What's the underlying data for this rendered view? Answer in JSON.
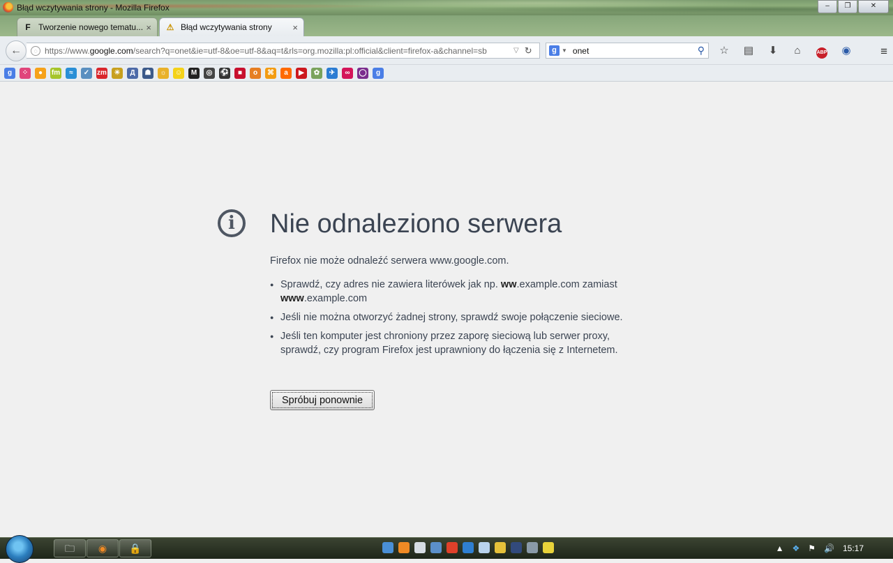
{
  "window": {
    "title": "Błąd wczytywania strony - Mozilla Firefox",
    "minimize": "‒",
    "maximize": "❐",
    "close": "✕"
  },
  "tabs": [
    {
      "label": "Tworzenie nowego tematu...",
      "favicon": "F",
      "close": "×"
    },
    {
      "label": "Błąd wczytywania strony",
      "favicon": "⚠",
      "close": "×"
    }
  ],
  "new_tab": "+",
  "navbar": {
    "back": "←",
    "url_prefix": "https://www.",
    "url_host": "google.com",
    "url_rest": "/search?q=onet&ie=utf-8&oe=utf-8&aq=t&rls=org.mozilla:pl:official&client=firefox-a&channel=sb",
    "url_drop": "▽",
    "reload": "↻",
    "search_engine_icon": "g",
    "search_drop": "▼",
    "search_value": "onet",
    "search_icon": "⚲",
    "icons": [
      "☆",
      "▤",
      "⬇",
      "⌂",
      "ABP",
      "◉"
    ],
    "menu": "≡"
  },
  "bookmarks": [
    {
      "label": "g",
      "color": "#4a7ee6"
    },
    {
      "label": "⁘",
      "color": "#e0457b"
    },
    {
      "label": "●",
      "color": "#f6a21a"
    },
    {
      "label": "fm",
      "color": "#a6c52a"
    },
    {
      "label": "≈",
      "color": "#2a8fd6"
    },
    {
      "label": "✓",
      "color": "#5a8fc0"
    },
    {
      "label": "zm",
      "color": "#d9262c"
    },
    {
      "label": "☀",
      "color": "#c8a01e"
    },
    {
      "label": "Д",
      "color": "#4c6aa8"
    },
    {
      "label": "☗",
      "color": "#3c5a8a"
    },
    {
      "label": "☼",
      "color": "#e9b12a"
    },
    {
      "label": "☺",
      "color": "#f4d21a"
    },
    {
      "label": "M",
      "color": "#222222"
    },
    {
      "label": "◎",
      "color": "#444444"
    },
    {
      "label": "⚽",
      "color": "#333333"
    },
    {
      "label": "■",
      "color": "#c8102e"
    },
    {
      "label": "o",
      "color": "#e67e22"
    },
    {
      "label": "⌘",
      "color": "#f39c12"
    },
    {
      "label": "a",
      "color": "#ff6a00"
    },
    {
      "label": "▶",
      "color": "#cc181e"
    },
    {
      "label": "✿",
      "color": "#7aa35c"
    },
    {
      "label": "✈",
      "color": "#2b7cd3"
    },
    {
      "label": "∞",
      "color": "#d4145a"
    },
    {
      "label": "◯",
      "color": "#7b2d8e"
    },
    {
      "label": "g",
      "color": "#4a7ee6"
    }
  ],
  "error": {
    "title": "Nie odnaleziono serwera",
    "description": "Firefox nie może odnaleźć serwera www.google.com.",
    "tip1_a": "Sprawdź, czy adres nie zawiera literówek jak np. ",
    "tip1_b1": "ww",
    "tip1_c": ".example.com zamiast ",
    "tip1_b2": "www",
    "tip1_d": ".example.com",
    "tip2": "Jeśli nie można otworzyć żadnej strony, sprawdź swoje połączenie sieciowe.",
    "tip3": "Jeśli ten komputer jest chroniony przez zaporę sieciową lub serwer proxy, sprawdź, czy program Firefox jest uprawniony do łączenia się z Internetem.",
    "retry_button": "Spróbuj ponownie",
    "info_glyph": "i"
  },
  "taskbar": {
    "apps": [
      "🗀",
      "◉",
      "🔒"
    ],
    "tray_arrow": "▲",
    "tray_icons": [
      "❖",
      "⚑",
      "🔊"
    ],
    "clock": "15:17"
  }
}
